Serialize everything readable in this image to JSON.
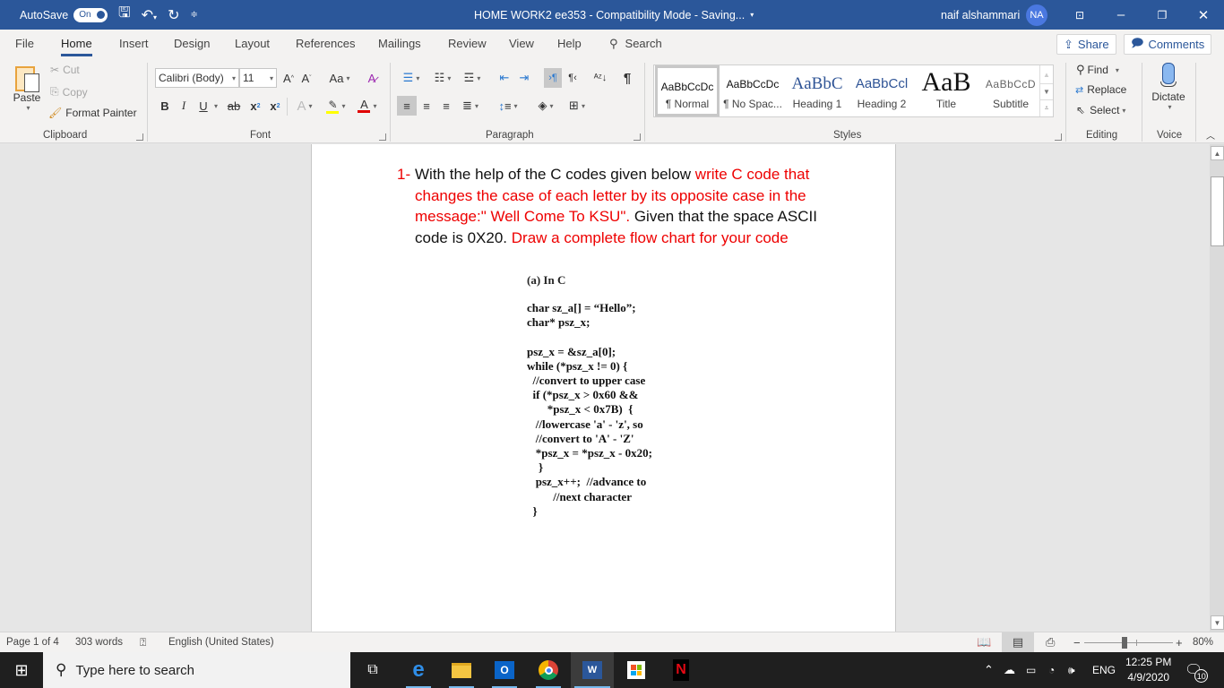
{
  "titlebar": {
    "autosave_label": "AutoSave",
    "autosave_state": "On",
    "doc_title": "HOME WORK2 ee353  -  Compatibility Mode  -  Saving...",
    "user_name": "naif alshammari",
    "user_initials": "NA"
  },
  "menu": {
    "tabs": [
      "File",
      "Home",
      "Insert",
      "Design",
      "Layout",
      "References",
      "Mailings",
      "Review",
      "View",
      "Help"
    ],
    "active_tab": "Home",
    "search_label": "Search",
    "share_label": "Share",
    "comments_label": "Comments"
  },
  "ribbon": {
    "clipboard": {
      "paste": "Paste",
      "cut": "Cut",
      "copy": "Copy",
      "format_painter": "Format Painter",
      "label": "Clipboard"
    },
    "font": {
      "font_name": "Calibri (Body)",
      "font_size": "11",
      "change_case": "Aa",
      "bold": "B",
      "italic": "I",
      "underline": "U",
      "strike": "ab",
      "subscript": "x",
      "superscript": "x",
      "label": "Font",
      "highlight_color": "#ffff00",
      "font_color": "#e00000"
    },
    "paragraph": {
      "label": "Paragraph"
    },
    "styles": {
      "label": "Styles",
      "items": [
        {
          "preview": "AaBbCcDc",
          "name": "¶ Normal"
        },
        {
          "preview": "AaBbCcDc",
          "name": "¶ No Spac..."
        },
        {
          "preview": "AaBbC",
          "name": "Heading 1"
        },
        {
          "preview": "AaBbCcl",
          "name": "Heading 2"
        },
        {
          "preview": "AaB",
          "name": "Title"
        },
        {
          "preview": "AaBbCcD",
          "name": "Subtitle"
        }
      ]
    },
    "editing": {
      "find": "Find",
      "replace": "Replace",
      "select": "Select",
      "label": "Editing"
    },
    "voice": {
      "dictate": "Dictate",
      "label": "Voice"
    }
  },
  "document": {
    "question_number": "1-",
    "q_part1": "With the help of the C codes given below ",
    "q_part2": "write C code that changes the case of each letter by its opposite case in the message:\" Well Come To KSU\".",
    "q_part3": " Given that the space ASCII code is 0X20.   ",
    "q_part4": "Draw a complete flow chart for your code",
    "code_heading": "(a) In C",
    "code_lines": "char sz_a[] = “Hello”;\nchar* psz_x;\n\npsz_x = &sz_a[0];\nwhile (*psz_x != 0) {\n  //convert to upper case\n  if (*psz_x > 0x60 &&\n       *psz_x < 0x7B)  {\n   //lowercase 'a' - 'z', so\n   //convert to 'A' - 'Z'\n   *psz_x = *psz_x - 0x20;\n    }\n   psz_x++;  //advance to\n         //next character\n  }"
  },
  "statusbar": {
    "page": "Page 1 of 4",
    "words": "303 words",
    "language": "English (United States)",
    "zoom": "80%",
    "zoom_percent": 80
  },
  "taskbar": {
    "search_placeholder": "Type here to search",
    "apps": [
      "task-view",
      "edge",
      "file-explorer",
      "outlook",
      "chrome",
      "word",
      "store",
      "netflix"
    ],
    "language": "ENG",
    "time": "12:25 PM",
    "date": "4/9/2020",
    "notification_count": "10"
  }
}
